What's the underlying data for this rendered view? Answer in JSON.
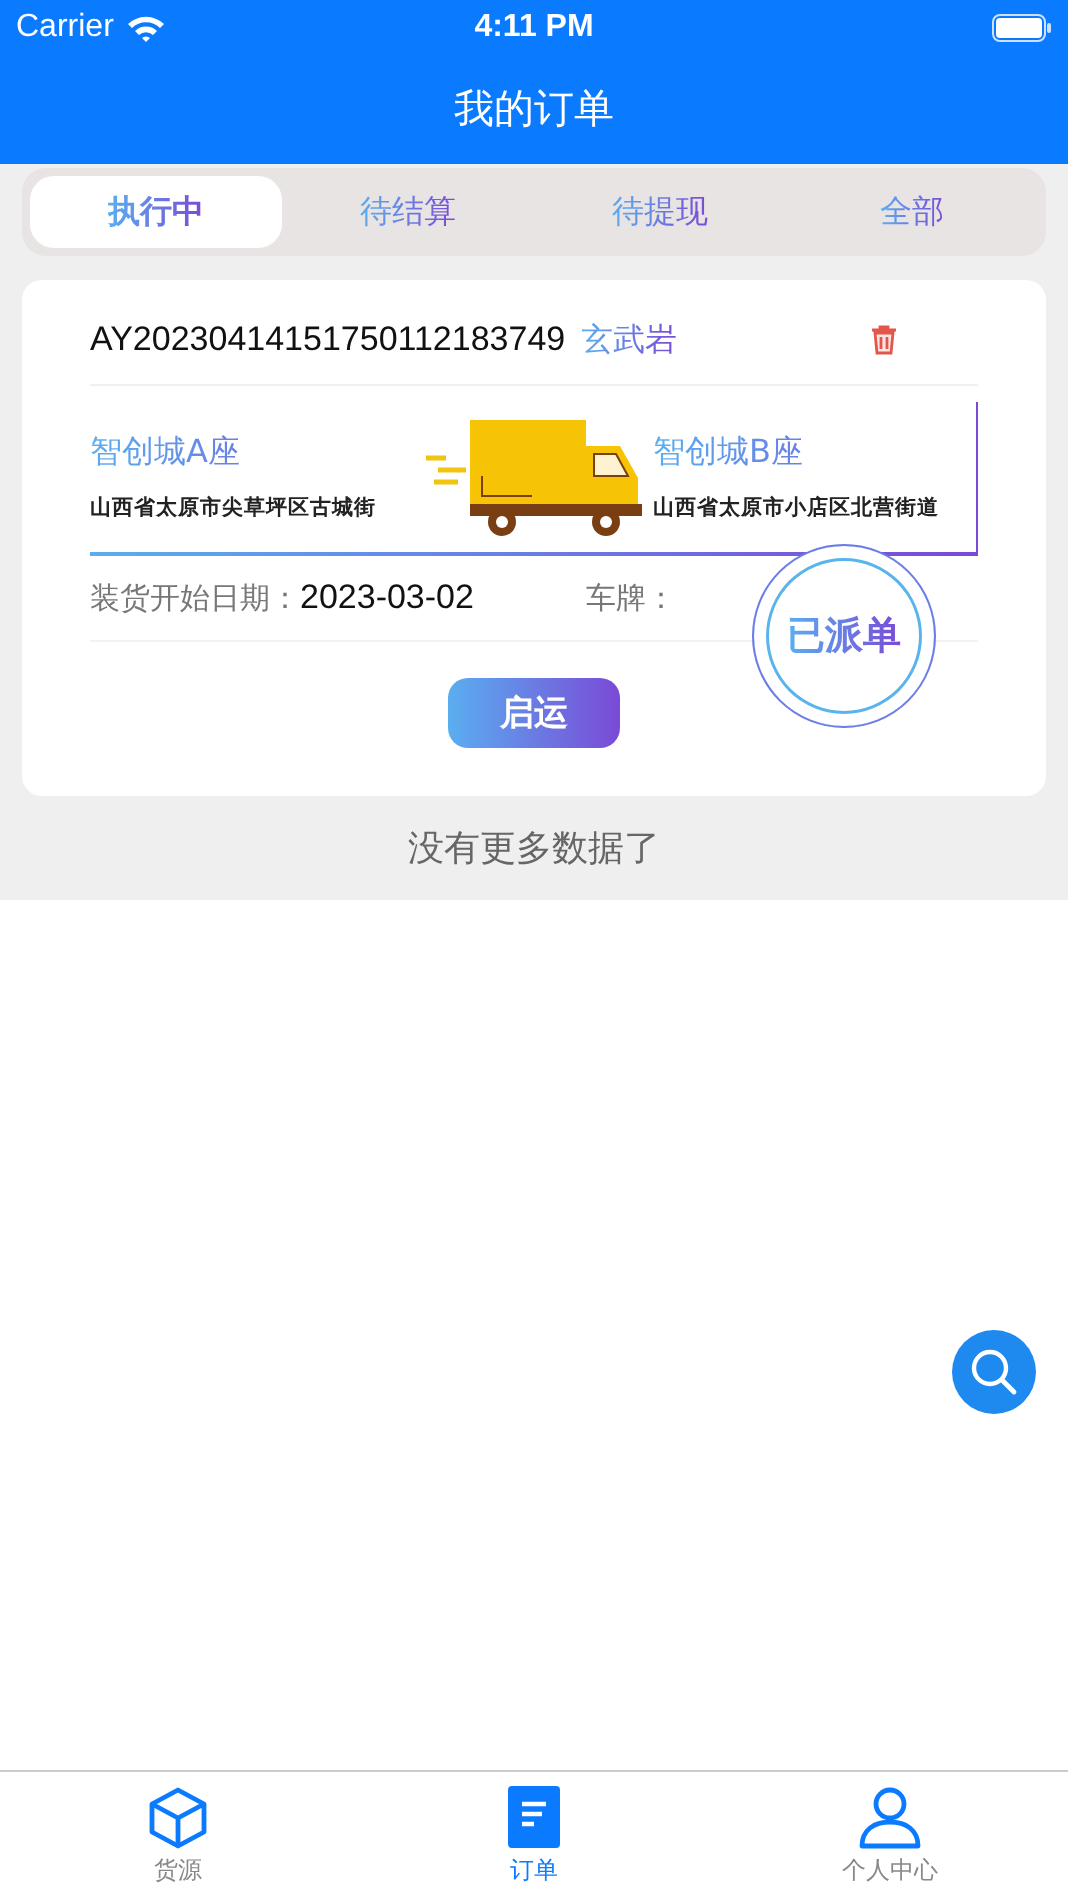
{
  "status_bar": {
    "carrier": "Carrier",
    "time": "4:11 PM"
  },
  "nav": {
    "title": "我的订单"
  },
  "tabs": [
    {
      "label": "执行中",
      "selected": true
    },
    {
      "label": "待结算",
      "selected": false
    },
    {
      "label": "待提现",
      "selected": false
    },
    {
      "label": "全部",
      "selected": false
    }
  ],
  "orders": [
    {
      "order_no": "AY20230414151750112183749",
      "cargo": "玄武岩",
      "from_name": "智创城A座",
      "from_address": "山西省太原市尖草坪区古城街",
      "to_name": "智创城B座",
      "to_address": "山西省太原市小店区北营街道",
      "date_label": "装货开始日期：",
      "date": "2023-03-02",
      "plate_label": "车牌：",
      "stamp": "已派单",
      "action": "启运"
    }
  ],
  "list_end": "没有更多数据了",
  "bottom_tabs": [
    {
      "label": "货源",
      "selected": false
    },
    {
      "label": "订单",
      "selected": true
    },
    {
      "label": "个人中心",
      "selected": false
    }
  ]
}
